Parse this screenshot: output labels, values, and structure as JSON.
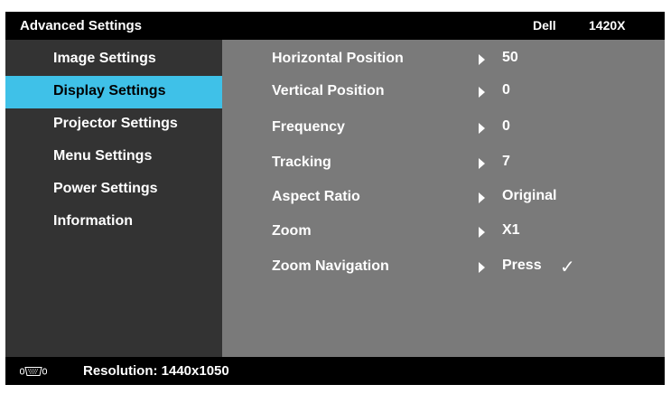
{
  "header": {
    "title": "Advanced Settings",
    "brand": "Dell",
    "model": "1420X"
  },
  "sidebar": {
    "items": [
      {
        "label": "Image Settings",
        "active": false
      },
      {
        "label": "Display Settings",
        "active": true
      },
      {
        "label": "Projector Settings",
        "active": false
      },
      {
        "label": "Menu Settings",
        "active": false
      },
      {
        "label": "Power Settings",
        "active": false
      },
      {
        "label": "Information",
        "active": false
      }
    ]
  },
  "main": {
    "rows": [
      {
        "label": "Horizontal Position",
        "value": "50"
      },
      {
        "label": "Vertical Position",
        "value": "0"
      },
      {
        "label": "Frequency",
        "value": "0"
      },
      {
        "label": "Tracking",
        "value": "7"
      },
      {
        "label": "Aspect Ratio",
        "value": "Original"
      },
      {
        "label": "Zoom",
        "value": "X1"
      },
      {
        "label": "Zoom Navigation",
        "value": "Press",
        "check": "✓"
      }
    ]
  },
  "footer": {
    "input_icon": "vga-connector-icon",
    "resolution": "Resolution: 1440x1050"
  },
  "colors": {
    "highlight": "#3fc1e8",
    "sidebar_bg": "#333333",
    "main_bg": "#7a7a7a",
    "bar_bg": "#000000"
  }
}
